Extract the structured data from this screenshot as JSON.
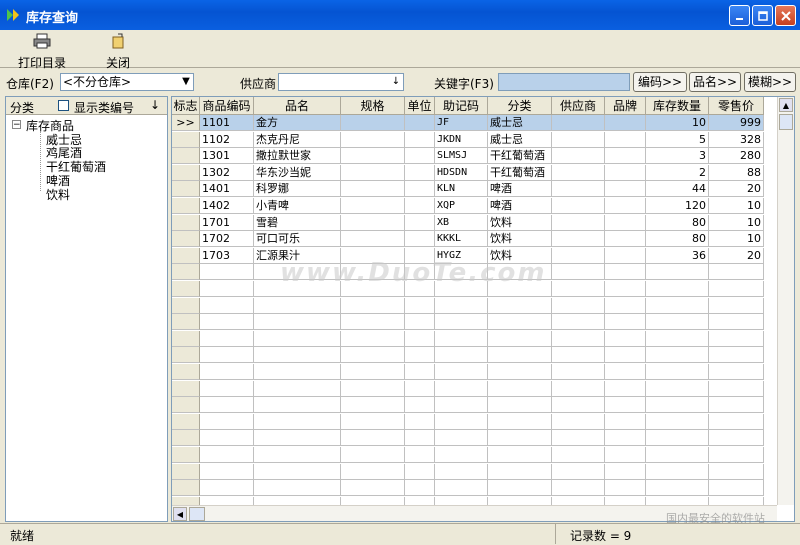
{
  "window": {
    "title": "库存查询"
  },
  "toolbar": {
    "print_label": "打印目录",
    "close_label": "关闭"
  },
  "filters": {
    "warehouse_label": "仓库(F2)",
    "warehouse_value": "<不分仓库>",
    "supplier_label": "供应商",
    "supplier_value": "",
    "keyword_label": "关键字(F3)",
    "keyword_value": "",
    "btn_code": "编码>>",
    "btn_name": "品名>>",
    "btn_fuzzy": "模糊>>"
  },
  "left": {
    "header": "分类",
    "show_code_label": "显示类编号",
    "tree_root": "库存商品",
    "tree_children": [
      "威士忌",
      "鸡尾酒",
      "干红葡萄酒",
      "啤酒",
      "饮料"
    ]
  },
  "grid": {
    "columns": [
      "标志",
      "商品编码",
      "品名",
      "规格",
      "单位",
      "助记码",
      "分类",
      "供应商",
      "品牌",
      "库存数量",
      "零售价"
    ],
    "rows": [
      {
        "mark": ">>",
        "code": "1101",
        "name": "金方",
        "spec": "",
        "unit": "",
        "mnemonic": "JF",
        "category": "威士忌",
        "supplier": "",
        "brand": "",
        "qty": "10",
        "price": "999"
      },
      {
        "mark": "",
        "code": "1102",
        "name": "杰克丹尼",
        "spec": "",
        "unit": "",
        "mnemonic": "JKDN",
        "category": "威士忌",
        "supplier": "",
        "brand": "",
        "qty": "5",
        "price": "328"
      },
      {
        "mark": "",
        "code": "1301",
        "name": "撒拉默世家",
        "spec": "",
        "unit": "",
        "mnemonic": "SLMSJ",
        "category": "干红葡萄酒",
        "supplier": "",
        "brand": "",
        "qty": "3",
        "price": "280"
      },
      {
        "mark": "",
        "code": "1302",
        "name": "华东沙当妮",
        "spec": "",
        "unit": "",
        "mnemonic": "HDSDN",
        "category": "干红葡萄酒",
        "supplier": "",
        "brand": "",
        "qty": "2",
        "price": "88"
      },
      {
        "mark": "",
        "code": "1401",
        "name": "科罗娜",
        "spec": "",
        "unit": "",
        "mnemonic": "KLN",
        "category": "啤酒",
        "supplier": "",
        "brand": "",
        "qty": "44",
        "price": "20"
      },
      {
        "mark": "",
        "code": "1402",
        "name": "小青啤",
        "spec": "",
        "unit": "",
        "mnemonic": "XQP",
        "category": "啤酒",
        "supplier": "",
        "brand": "",
        "qty": "120",
        "price": "10"
      },
      {
        "mark": "",
        "code": "1701",
        "name": "雪碧",
        "spec": "",
        "unit": "",
        "mnemonic": "XB",
        "category": "饮料",
        "supplier": "",
        "brand": "",
        "qty": "80",
        "price": "10"
      },
      {
        "mark": "",
        "code": "1702",
        "name": "可口可乐",
        "spec": "",
        "unit": "",
        "mnemonic": "KKKL",
        "category": "饮料",
        "supplier": "",
        "brand": "",
        "qty": "80",
        "price": "10"
      },
      {
        "mark": "",
        "code": "1703",
        "name": "汇源果汁",
        "spec": "",
        "unit": "",
        "mnemonic": "HYGZ",
        "category": "饮料",
        "supplier": "",
        "brand": "",
        "qty": "36",
        "price": "20"
      }
    ]
  },
  "status": {
    "left": "就绪",
    "record_count": "记录数 = 9"
  },
  "watermark": {
    "text": "www.DuoTe.com",
    "corner_text": "国内最安全的软件站"
  }
}
